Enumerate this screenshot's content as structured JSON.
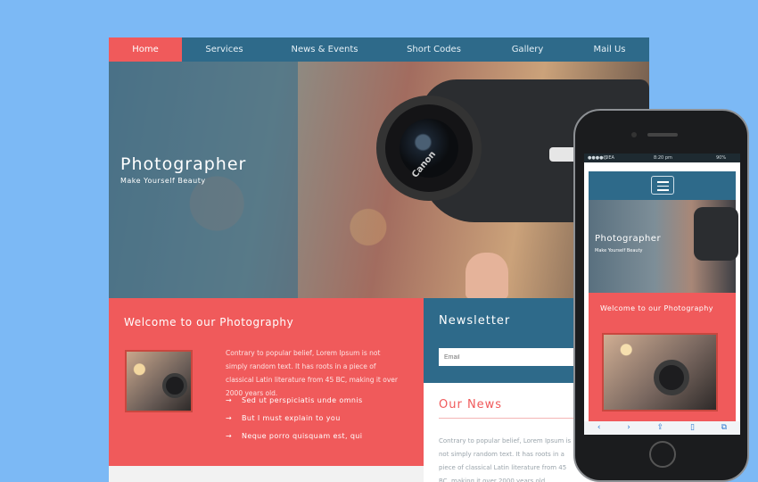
{
  "nav": {
    "items": [
      "Home",
      "Services",
      "News & Events",
      "Short Codes",
      "Gallery",
      "Mail Us"
    ],
    "active": "Home"
  },
  "hero": {
    "title": "Photographer",
    "subtitle": "Make Yourself Beauty",
    "camera_brand": "Canon"
  },
  "welcome": {
    "title": "Welcome to our Photography",
    "text": "Contrary to popular belief, Lorem Ipsum is not simply random text. It has roots in a piece of classical Latin literature from 45 BC, making it over 2000 years old.",
    "bullets": [
      "Sed ut perspiciatis unde omnis",
      "But I must explain to you",
      "Neque porro quisquam est, qui"
    ]
  },
  "newsletter": {
    "title": "Newsletter",
    "email_placeholder": "Email"
  },
  "news": {
    "title": "Our News",
    "text": "Contrary to popular belief, Lorem Ipsum is not simply random text. It has roots in a piece of classical Latin literature from 45 BC, making it over 2000 years old."
  },
  "phone": {
    "carrier": "IDEA",
    "time": "8:20 pm",
    "battery": "90%",
    "hero_title": "Photographer",
    "hero_subtitle": "Make Yourself Beauty",
    "welcome_title": "Welcome to our Photography",
    "toolbar_icons": [
      "back-icon",
      "forward-icon",
      "share-icon",
      "bookmarks-icon",
      "tabs-icon"
    ]
  },
  "colors": {
    "background": "#7cb9f5",
    "primary": "#2e6a8a",
    "accent": "#f05a5b"
  }
}
